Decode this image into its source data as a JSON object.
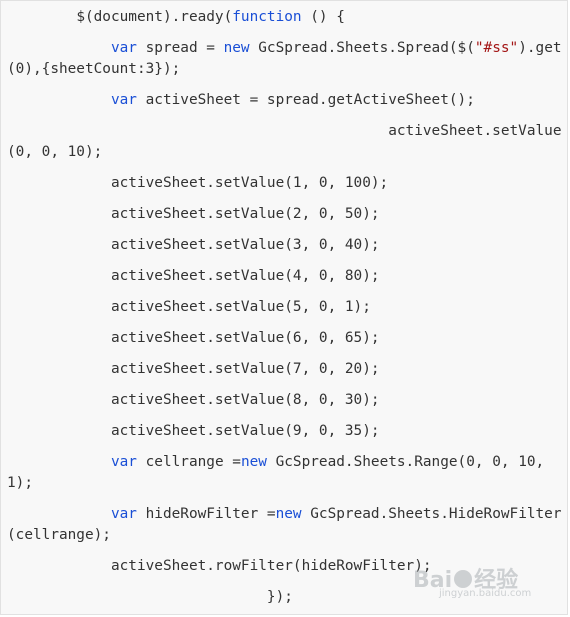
{
  "code_lines": [
    {
      "parts": [
        {
          "t": "        $(document).ready("
        },
        {
          "t": "function",
          "c": "kw"
        },
        {
          "t": " () {"
        }
      ]
    },
    {
      "parts": [
        {
          "t": "            "
        },
        {
          "t": "var",
          "c": "kw"
        },
        {
          "t": " spread = "
        },
        {
          "t": "new",
          "c": "kw"
        },
        {
          "t": " GcSpread.Sheets.Spread($("
        },
        {
          "t": "\"#ss\"",
          "c": "str"
        },
        {
          "t": ").get(0),{sheetCount:3});"
        }
      ]
    },
    {
      "parts": [
        {
          "t": "            "
        },
        {
          "t": "var",
          "c": "kw"
        },
        {
          "t": " activeSheet = spread.getActiveSheet();"
        }
      ]
    },
    {
      "parts": [
        {
          "t": "                                            activeSheet.setValue(0, 0, 10);"
        }
      ]
    },
    {
      "parts": [
        {
          "t": "            activeSheet.setValue(1, 0, 100);"
        }
      ]
    },
    {
      "parts": [
        {
          "t": "            activeSheet.setValue(2, 0, 50);"
        }
      ]
    },
    {
      "parts": [
        {
          "t": "            activeSheet.setValue(3, 0, 40);"
        }
      ]
    },
    {
      "parts": [
        {
          "t": "            activeSheet.setValue(4, 0, 80);"
        }
      ]
    },
    {
      "parts": [
        {
          "t": "            activeSheet.setValue(5, 0, 1);"
        }
      ]
    },
    {
      "parts": [
        {
          "t": "            activeSheet.setValue(6, 0, 65);"
        }
      ]
    },
    {
      "parts": [
        {
          "t": "            activeSheet.setValue(7, 0, 20);"
        }
      ]
    },
    {
      "parts": [
        {
          "t": "            activeSheet.setValue(8, 0, 30);"
        }
      ]
    },
    {
      "parts": [
        {
          "t": "            activeSheet.setValue(9, 0, 35);"
        }
      ]
    },
    {
      "parts": [
        {
          "t": "            "
        },
        {
          "t": "var",
          "c": "kw"
        },
        {
          "t": " cellrange ="
        },
        {
          "t": "new",
          "c": "kw"
        },
        {
          "t": " GcSpread.Sheets.Range(0, 0, 10, 1);"
        }
      ]
    },
    {
      "parts": [
        {
          "t": "            "
        },
        {
          "t": "var",
          "c": "kw"
        },
        {
          "t": " hideRowFilter ="
        },
        {
          "t": "new",
          "c": "kw"
        },
        {
          "t": " GcSpread.Sheets.HideRowFilter(cellrange);"
        }
      ]
    },
    {
      "parts": [
        {
          "t": "            activeSheet.rowFilter(hideRowFilter);"
        }
      ]
    },
    {
      "parts": [
        {
          "t": "                              });"
        }
      ]
    }
  ],
  "watermark": {
    "brand": "Bai",
    "brand_suffix": "经验",
    "url": "jingyan.baidu.com"
  },
  "colors": {
    "keyword": "#1a4fd6",
    "string": "#a31515",
    "text": "#333333",
    "background": "#f8f8f8"
  }
}
